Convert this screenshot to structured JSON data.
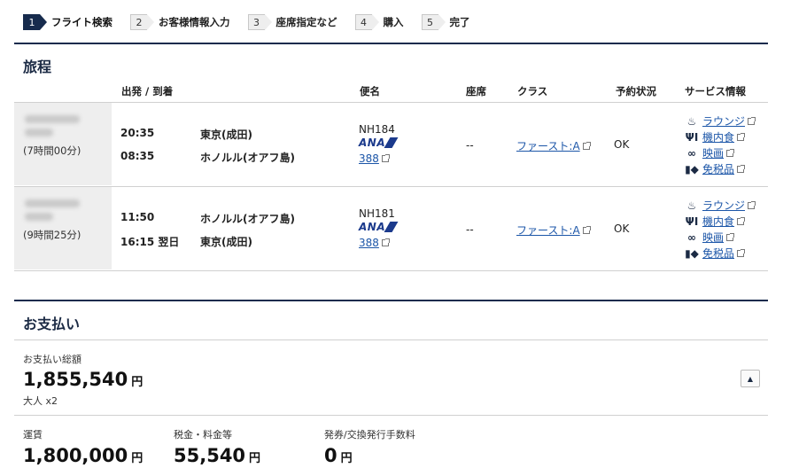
{
  "steps": [
    {
      "num": "1",
      "label": "フライト検索",
      "active": true
    },
    {
      "num": "2",
      "label": "お客様情報入力",
      "active": false
    },
    {
      "num": "3",
      "label": "座席指定など",
      "active": false
    },
    {
      "num": "4",
      "label": "購入",
      "active": false
    },
    {
      "num": "5",
      "label": "完了",
      "active": false
    }
  ],
  "itinerary": {
    "title": "旅程",
    "headers": {
      "dep_arr": "出発 / 到着",
      "flight": "便名",
      "seat": "座席",
      "class": "クラス",
      "status": "予約状況",
      "services": "サービス情報"
    },
    "rows": [
      {
        "duration": "(7時間00分)",
        "dep_time": "20:35",
        "dep_place": "東京(成田)",
        "arr_time": "08:35",
        "arr_place": "ホノルル(オアフ島)",
        "flight_no": "NH184",
        "airline": "ANA",
        "aircraft": "388",
        "seat": "--",
        "class": "ファースト:A",
        "status": "OK",
        "services": [
          "ラウンジ",
          "機内食",
          "映画",
          "免税品"
        ]
      },
      {
        "duration": "(9時間25分)",
        "dep_time": "11:50",
        "dep_place": "ホノルル(オアフ島)",
        "arr_time": "16:15 翌日",
        "arr_place": "東京(成田)",
        "flight_no": "NH181",
        "airline": "ANA",
        "aircraft": "388",
        "seat": "--",
        "class": "ファースト:A",
        "status": "OK",
        "services": [
          "ラウンジ",
          "機内食",
          "映画",
          "免税品"
        ]
      }
    ],
    "service_icons": [
      "lounge-icon",
      "meal-icon",
      "movie-icon",
      "dutyfree-icon"
    ]
  },
  "payment": {
    "title": "お支払い",
    "total_label": "お支払い総額",
    "total": "1,855,540",
    "currency": "円",
    "pax": "大人 x2",
    "fare_label": "運賃",
    "fare": "1,800,000",
    "tax_label": "税金・料金等",
    "tax": "55,540",
    "fee_label": "発券/交換発行手数料",
    "fee": "0"
  },
  "colors": {
    "navy": "#172b4d",
    "link": "#1c56a8",
    "row_bg": "#eeeeee"
  }
}
